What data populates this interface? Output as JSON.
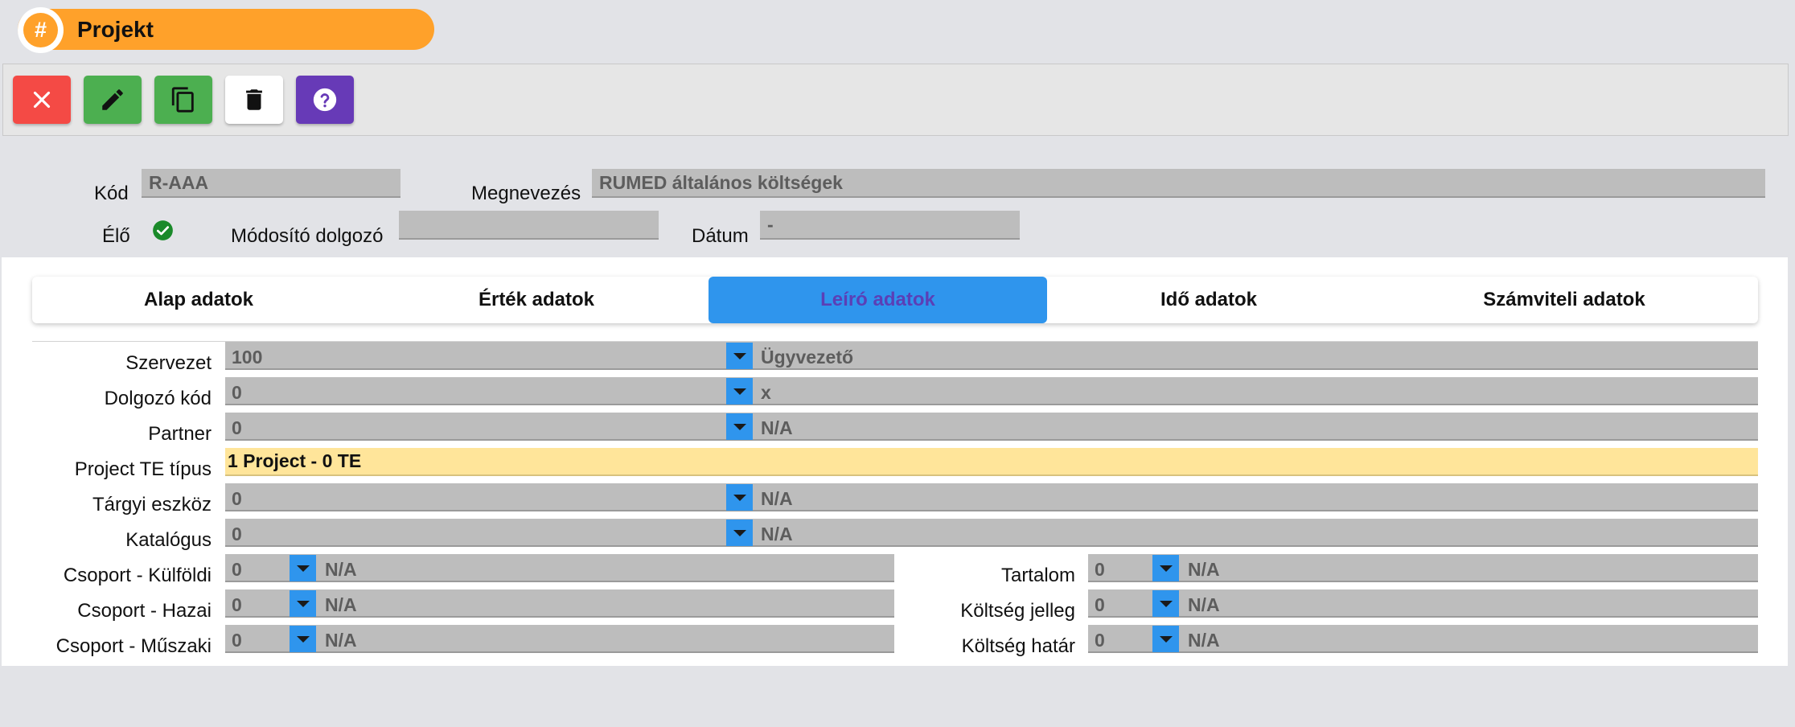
{
  "window": {
    "title": "Projekt",
    "title_icon": "hash-icon"
  },
  "toolbar": {
    "buttons": [
      {
        "name": "close",
        "icon": "close-icon",
        "color": "#f44a45"
      },
      {
        "name": "edit",
        "icon": "pencil-icon",
        "color": "#4caf50"
      },
      {
        "name": "copy",
        "icon": "copy-icon",
        "color": "#4caf50"
      },
      {
        "name": "delete",
        "icon": "trash-icon",
        "color": "#ffffff"
      },
      {
        "name": "help",
        "icon": "help-icon",
        "color": "#673ab7"
      }
    ]
  },
  "header": {
    "kod_label": "Kód",
    "kod_value": "R-AAA",
    "megnevezes_label": "Megnevezés",
    "megnevezes_value": "RUMED általános költségek",
    "elo_label": "Élő",
    "elo_icon": "check-circle-icon",
    "modosito_label": "Módosító dolgozó",
    "modosito_value": "",
    "datum_label": "Dátum",
    "datum_value": "-"
  },
  "tabs": [
    {
      "label": "Alap adatok",
      "active": false
    },
    {
      "label": "Érték adatok",
      "active": false
    },
    {
      "label": "Leíró adatok",
      "active": true
    },
    {
      "label": "Idő adatok",
      "active": false
    },
    {
      "label": "Számviteli adatok",
      "active": false
    }
  ],
  "fields": {
    "szervezet": {
      "label": "Szervezet",
      "code": "100",
      "name": "Ügyvezető"
    },
    "dolgozo_kod": {
      "label": "Dolgozó kód",
      "code": "0",
      "name": "x"
    },
    "partner": {
      "label": "Partner",
      "code": "0",
      "name": "N/A"
    },
    "project_te_tipus": {
      "label": "Project TE típus",
      "value": "1 Project - 0 TE"
    },
    "targyi_eszkoz": {
      "label": "Tárgyi eszköz",
      "code": "0",
      "name": "N/A"
    },
    "katalogus": {
      "label": "Katalógus",
      "code": "0",
      "name": "N/A"
    },
    "csoport_kulfoldi": {
      "label": "Csoport - Külföldi",
      "code": "0",
      "name": "N/A"
    },
    "csoport_hazai": {
      "label": "Csoport - Hazai",
      "code": "0",
      "name": "N/A"
    },
    "csoport_muszaki": {
      "label": "Csoport - Műszaki",
      "code": "0",
      "name": "N/A"
    },
    "tartalom": {
      "label": "Tartalom",
      "code": "0",
      "name": "N/A"
    },
    "koltseg_jelleg": {
      "label": "Költség jelleg",
      "code": "0",
      "name": "N/A"
    },
    "koltseg_hatar": {
      "label": "Költség határ",
      "code": "0",
      "name": "N/A"
    }
  }
}
